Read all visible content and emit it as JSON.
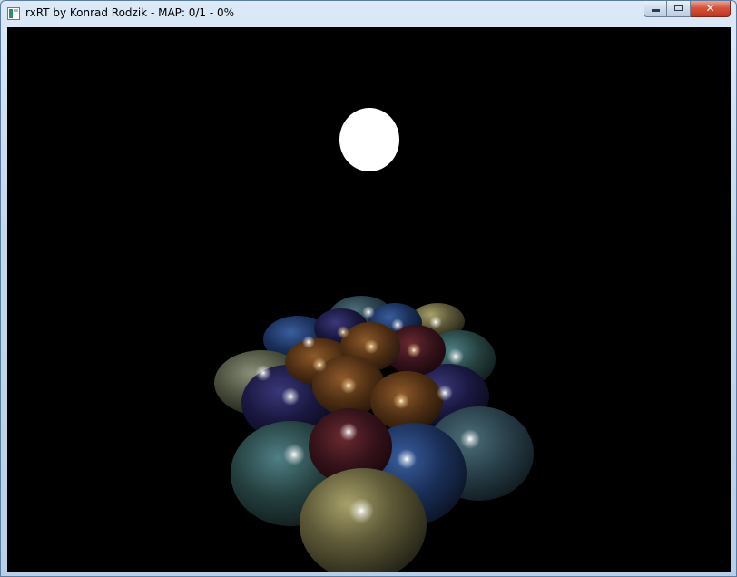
{
  "window": {
    "title": "rxRT by Konrad Rodzik - MAP: 0/1 - 0%",
    "icon": "app-window-icon",
    "controls": {
      "minimize_icon": "minimize-icon",
      "maximize_icon": "maximize-icon",
      "close_label": "✕"
    }
  },
  "viewport": {
    "background": "#000000",
    "light_color": "#ffffff",
    "sphere_colors": {
      "olive": "#6e6a44",
      "teal": "#2f4e52",
      "navy": "#1c3562",
      "indigo": "#1e1c4a",
      "brown": "#5e3a1a",
      "maroon": "#3b1418",
      "slate": "#2c4653",
      "sage": "#5d6351"
    }
  }
}
